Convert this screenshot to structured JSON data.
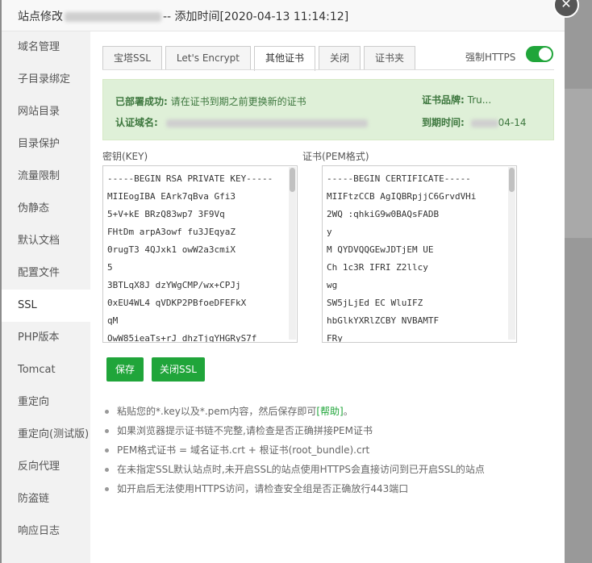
{
  "title": {
    "prefix": "站点修改",
    "suffix": "-- 添加时间[2020-04-13 11:14:12]"
  },
  "sidebar": {
    "items": [
      {
        "label": "域名管理"
      },
      {
        "label": "子目录绑定"
      },
      {
        "label": "网站目录"
      },
      {
        "label": "目录保护"
      },
      {
        "label": "流量限制"
      },
      {
        "label": "伪静态"
      },
      {
        "label": "默认文档"
      },
      {
        "label": "配置文件"
      },
      {
        "label": "SSL",
        "active": true
      },
      {
        "label": "PHP版本"
      },
      {
        "label": "Tomcat"
      },
      {
        "label": "重定向"
      },
      {
        "label": "重定向(测试版)"
      },
      {
        "label": "反向代理"
      },
      {
        "label": "防盗链"
      },
      {
        "label": "响应日志"
      }
    ]
  },
  "tabs": [
    "宝塔SSL",
    "Let's Encrypt",
    "其他证书",
    "关闭",
    "证书夹"
  ],
  "force_https": {
    "label": "强制HTTPS",
    "on": true
  },
  "alert": {
    "deployed_label": "已部署成功:",
    "deployed_msg": "请在证书到期之前更换新的证书",
    "domain_label": "认证域名:",
    "brand_label": "证书品牌:",
    "brand_value": "Tru...",
    "expire_label": "到期时间:",
    "expire_value": "04-14"
  },
  "key_label": "密钥(KEY)",
  "pem_label": "证书(PEM格式)",
  "key_lines": [
    "-----BEGIN RSA PRIVATE KEY-----",
    "MIIEogIBA       EArk7qBva    Gfi3",
    "5+V+kE       BRzQ83wp7     3F9Vq",
    "FHtDm      arpA3owf      fu3JEqyaZ",
    "0rugT3      4QJxk1      owW2a3cmiX",
    "5",
    "3BTLqX8J      dzYWgCMP/wx+CPJj",
    "0xEU4WL4      qVDKP2PBfoeDFEFkX",
    "qM",
    "OwW85ieaTs+rJ      dhzTjqYHGRyS7f"
  ],
  "pem_lines": [
    "-----BEGIN CERTIFICATE-----",
    "MIIFtzCCB       AgIQBRpjjC6GrvdVHi",
    "2WQ          :qhkiG9w0BAQsFADB",
    "y",
    "M       QYDVQQGEwJDTjEM       UE",
    "Ch       1c3R     IFRI       Z2llcy",
    "wg",
    "SW5jLjEd         EC          WluIFZ",
    "hbGlkYXRlZCBY         NVBAMTF",
    "FRy"
  ],
  "buttons": {
    "save": "保存",
    "close_ssl": "关闭SSL"
  },
  "tips": {
    "t1_pre": "粘贴您的*.key以及*.pem内容，然后保存即可",
    "t1_link": "[帮助]",
    "t1_post": "。",
    "t2": "如果浏览器提示证书链不完整,请检查是否正确拼接PEM证书",
    "t3": "PEM格式证书 = 域名证书.crt + 根证书(root_bundle).crt",
    "t4": "在未指定SSL默认站点时,未开启SSL的站点使用HTTPS会直接访问到已开启SSL的站点",
    "t5": "如开启后无法使用HTTPS访问，请检查安全组是否正确放行443端口"
  },
  "colors": {
    "accent": "#20a53a",
    "alert_bg": "#dff0d8",
    "alert_text": "#3c763d"
  }
}
